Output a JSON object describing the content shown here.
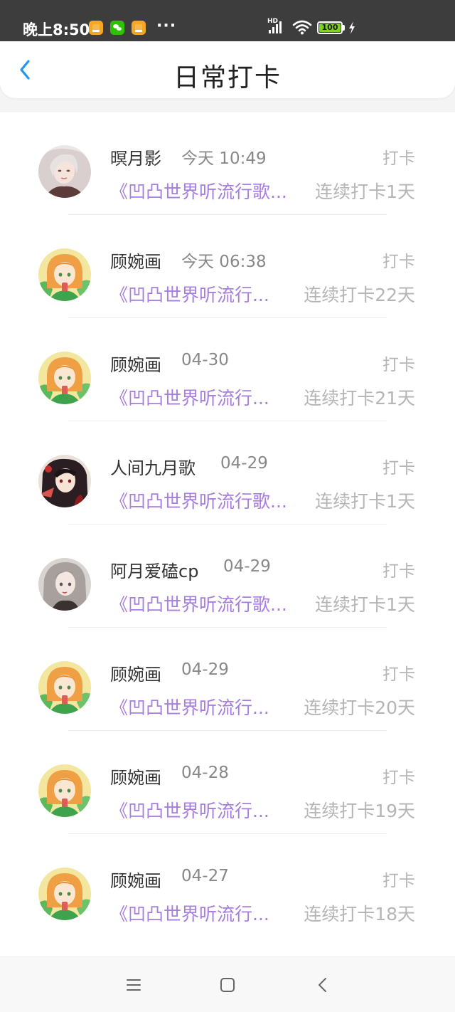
{
  "status_bar": {
    "time": "晚上8:50",
    "more": "···",
    "network_label": "HD",
    "battery_level": "100",
    "notification_icons": [
      "orange-app-icon",
      "wechat-icon",
      "orange-app-icon"
    ]
  },
  "header": {
    "title": "日常打卡",
    "back_icon": "chevron-left-icon"
  },
  "list": [
    {
      "user": "暝月影",
      "time": "今天 10:49",
      "label": "打卡",
      "book": "《凹凸世界听流行歌...",
      "streak": "连续打卡1天",
      "avatar": "girl-pale"
    },
    {
      "user": "顾婉画",
      "time": "今天 06:38",
      "label": "打卡",
      "book": "《凹凸世界听流行...",
      "streak": "连续打卡22天",
      "avatar": "girl-orange"
    },
    {
      "user": "顾婉画",
      "time": "04-30",
      "label": "打卡",
      "book": "《凹凸世界听流行...",
      "streak": "连续打卡21天",
      "avatar": "girl-orange"
    },
    {
      "user": "人间九月歌",
      "time": "04-29",
      "label": "打卡",
      "book": "《凹凸世界听流行歌...",
      "streak": "连续打卡1天",
      "avatar": "girl-dark"
    },
    {
      "user": "阿月爱磕cp",
      "time": "04-29",
      "label": "打卡",
      "book": "《凹凸世界听流行歌...",
      "streak": "连续打卡1天",
      "avatar": "girl-grey"
    },
    {
      "user": "顾婉画",
      "time": "04-29",
      "label": "打卡",
      "book": "《凹凸世界听流行...",
      "streak": "连续打卡20天",
      "avatar": "girl-orange"
    },
    {
      "user": "顾婉画",
      "time": "04-28",
      "label": "打卡",
      "book": "《凹凸世界听流行...",
      "streak": "连续打卡19天",
      "avatar": "girl-orange"
    },
    {
      "user": "顾婉画",
      "time": "04-27",
      "label": "打卡",
      "book": "《凹凸世界听流行...",
      "streak": "连续打卡18天",
      "avatar": "girl-orange"
    }
  ],
  "nav_bar": {
    "icons": [
      "menu-icon",
      "home-square-icon",
      "back-triangle-icon"
    ]
  },
  "colors": {
    "accent": "#2196f3",
    "book_title": "#a77de0",
    "muted": "#b5b5b5",
    "status_bar_bg": "#3d3d3d"
  }
}
